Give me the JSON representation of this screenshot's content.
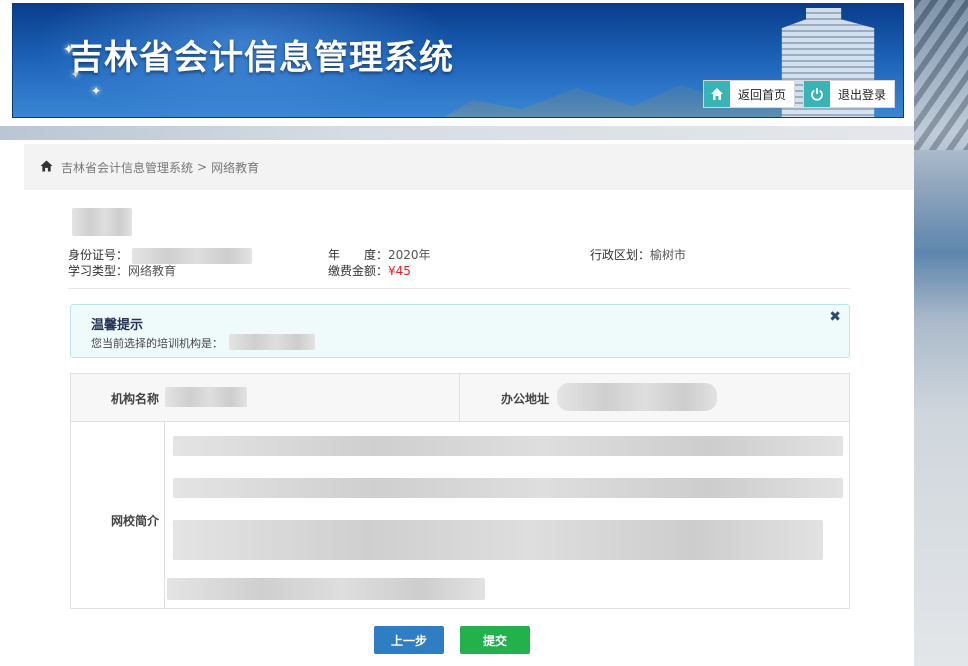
{
  "header": {
    "title": "吉林省会计信息管理系统",
    "home_button": "返回首页",
    "logout_button": "退出登录"
  },
  "breadcrumb": {
    "root": "吉林省会计信息管理系统",
    "separator": ">",
    "current": "网络教育"
  },
  "profile": {
    "id_label": "身份证号：",
    "study_type_label": "学习类型：",
    "study_type_value": "网络教育",
    "year_label": "年　　度：",
    "year_value": "2020年",
    "fee_label": "缴费金额：",
    "fee_value": "¥45",
    "district_label": "行政区划：",
    "district_value": "榆树市"
  },
  "tip": {
    "title": "温馨提示",
    "message": "您当前选择的培训机构是："
  },
  "institution": {
    "name_label": "机构名称",
    "address_label": "办公地址",
    "intro_label": "网校简介"
  },
  "actions": {
    "prev": "上一步",
    "submit": "提交"
  },
  "colors": {
    "accent_teal": "#39b3b3",
    "prev_button": "#2f7ec4",
    "submit_button": "#22b14c",
    "fee_red": "#e02020"
  }
}
